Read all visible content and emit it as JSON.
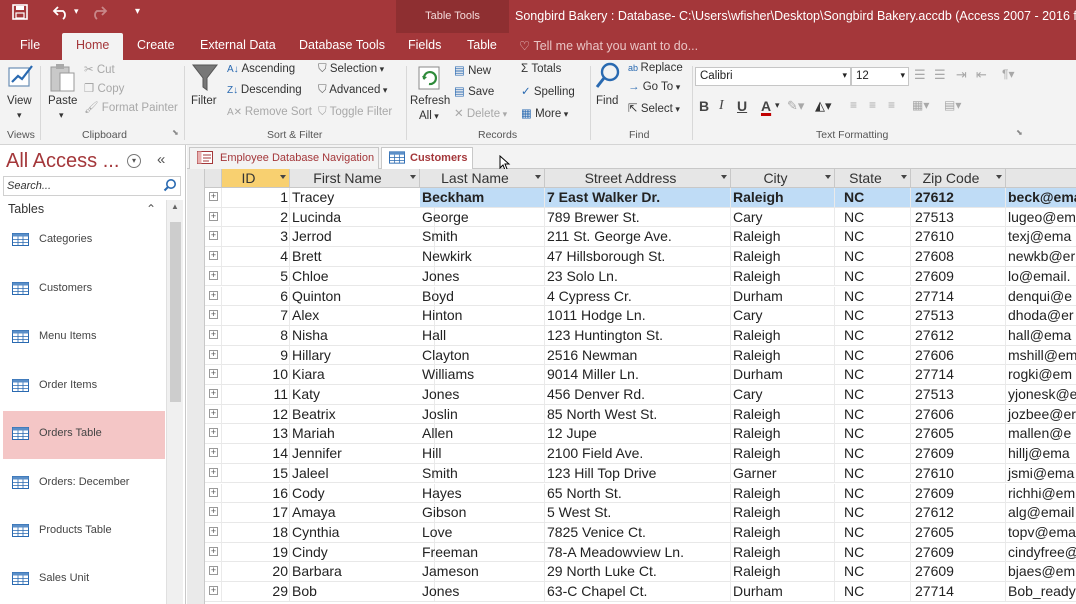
{
  "titlebar": {
    "context_label": "Table Tools",
    "window_title": "Songbird Bakery : Database- C:\\Users\\wfisher\\Desktop\\Songbird Bakery.accdb (Access 2007 - 2016 file fo"
  },
  "tabs": [
    "File",
    "Home",
    "Create",
    "External Data",
    "Database Tools",
    "Fields",
    "Table"
  ],
  "tell_me": "Tell me what you want to do...",
  "ribbon": {
    "views": {
      "view": "View",
      "group": "Views"
    },
    "clipboard": {
      "paste": "Paste",
      "cut": "Cut",
      "copy": "Copy",
      "format_painter": "Format Painter",
      "group": "Clipboard"
    },
    "sort_filter": {
      "filter": "Filter",
      "ascending": "Ascending",
      "descending": "Descending",
      "remove_sort": "Remove Sort",
      "selection": "Selection",
      "advanced": "Advanced",
      "toggle_filter": "Toggle Filter",
      "group": "Sort & Filter"
    },
    "records": {
      "refresh": "Refresh",
      "all": "All",
      "new": "New",
      "save": "Save",
      "delete": "Delete",
      "totals": "Totals",
      "spelling": "Spelling",
      "more": "More",
      "group": "Records"
    },
    "find": {
      "find": "Find",
      "replace": "Replace",
      "goto": "Go To",
      "select": "Select",
      "group": "Find"
    },
    "text_formatting": {
      "font": "Calibri",
      "size": "12",
      "bold": "B",
      "italic": "I",
      "underline": "U",
      "font_color": "A",
      "group": "Text Formatting"
    }
  },
  "nav": {
    "title": "All Access ...",
    "search_placeholder": "Search...",
    "section": "Tables",
    "items": [
      {
        "label": "Categories"
      },
      {
        "label": "Customers"
      },
      {
        "label": "Menu Items"
      },
      {
        "label": "Order Items"
      },
      {
        "label": "Orders Table"
      },
      {
        "label": "Orders: December"
      },
      {
        "label": "Products Table"
      },
      {
        "label": "Sales Unit"
      }
    ]
  },
  "doc_tabs": [
    {
      "label": "Employee Database Navigation"
    },
    {
      "label": "Customers"
    }
  ],
  "columns": [
    "ID",
    "First Name",
    "Last Name",
    "Street Address",
    "City",
    "State",
    "Zip Code"
  ],
  "rows": [
    {
      "id": "1",
      "first": "Tracey",
      "last": "Beckham",
      "street": "7 East Walker Dr.",
      "city": "Raleigh",
      "state": "NC",
      "zip": "27612",
      "email": "beck@ema"
    },
    {
      "id": "2",
      "first": "Lucinda",
      "last": "George",
      "street": "789 Brewer St.",
      "city": "Cary",
      "state": "NC",
      "zip": "27513",
      "email": "lugeo@em"
    },
    {
      "id": "3",
      "first": "Jerrod",
      "last": "Smith",
      "street": "211 St. George Ave.",
      "city": "Raleigh",
      "state": "NC",
      "zip": "27610",
      "email": "texj@ema"
    },
    {
      "id": "4",
      "first": "Brett",
      "last": "Newkirk",
      "street": "47 Hillsborough St.",
      "city": "Raleigh",
      "state": "NC",
      "zip": "27608",
      "email": "newkb@er"
    },
    {
      "id": "5",
      "first": "Chloe",
      "last": "Jones",
      "street": "23 Solo Ln.",
      "city": "Raleigh",
      "state": "NC",
      "zip": "27609",
      "email": "lo@email."
    },
    {
      "id": "6",
      "first": "Quinton",
      "last": "Boyd",
      "street": "4 Cypress Cr.",
      "city": "Durham",
      "state": "NC",
      "zip": "27714",
      "email": "denqui@e"
    },
    {
      "id": "7",
      "first": "Alex",
      "last": "Hinton",
      "street": "1011 Hodge Ln.",
      "city": "Cary",
      "state": "NC",
      "zip": "27513",
      "email": "dhoda@er"
    },
    {
      "id": "8",
      "first": "Nisha",
      "last": "Hall",
      "street": "123 Huntington St.",
      "city": "Raleigh",
      "state": "NC",
      "zip": "27612",
      "email": "hall@ema"
    },
    {
      "id": "9",
      "first": "Hillary",
      "last": "Clayton",
      "street": "2516 Newman",
      "city": "Raleigh",
      "state": "NC",
      "zip": "27606",
      "email": "mshill@em"
    },
    {
      "id": "10",
      "first": "Kiara",
      "last": "Williams",
      "street": "9014 Miller Ln.",
      "city": "Durham",
      "state": "NC",
      "zip": "27714",
      "email": "rogki@em"
    },
    {
      "id": "11",
      "first": "Katy",
      "last": "Jones",
      "street": "456 Denver Rd.",
      "city": "Cary",
      "state": "NC",
      "zip": "27513",
      "email": "yjonesk@e"
    },
    {
      "id": "12",
      "first": "Beatrix",
      "last": "Joslin",
      "street": "85 North West St.",
      "city": "Raleigh",
      "state": "NC",
      "zip": "27606",
      "email": "jozbee@er"
    },
    {
      "id": "13",
      "first": "Mariah",
      "last": "Allen",
      "street": "12 Jupe",
      "city": "Raleigh",
      "state": "NC",
      "zip": "27605",
      "email": "mallen@e"
    },
    {
      "id": "14",
      "first": "Jennifer",
      "last": "Hill",
      "street": "2100 Field Ave.",
      "city": "Raleigh",
      "state": "NC",
      "zip": "27609",
      "email": "hillj@ema"
    },
    {
      "id": "15",
      "first": "Jaleel",
      "last": "Smith",
      "street": "123 Hill Top Drive",
      "city": "Garner",
      "state": "NC",
      "zip": "27610",
      "email": "jsmi@ema"
    },
    {
      "id": "16",
      "first": "Cody",
      "last": "Hayes",
      "street": "65 North St.",
      "city": "Raleigh",
      "state": "NC",
      "zip": "27609",
      "email": "richhi@em"
    },
    {
      "id": "17",
      "first": "Amaya",
      "last": "Gibson",
      "street": "5 West St.",
      "city": "Raleigh",
      "state": "NC",
      "zip": "27612",
      "email": "alg@email"
    },
    {
      "id": "18",
      "first": "Cynthia",
      "last": "Love",
      "street": "7825 Venice Ct.",
      "city": "Raleigh",
      "state": "NC",
      "zip": "27605",
      "email": "topv@ema"
    },
    {
      "id": "19",
      "first": "Cindy",
      "last": "Freeman",
      "street": "78-A Meadowview Ln.",
      "city": "Raleigh",
      "state": "NC",
      "zip": "27609",
      "email": "cindyfree@"
    },
    {
      "id": "20",
      "first": "Barbara",
      "last": "Jameson",
      "street": "29 North Luke Ct.",
      "city": "Raleigh",
      "state": "NC",
      "zip": "27609",
      "email": "bjaes@em"
    },
    {
      "id": "29",
      "first": "Bob",
      "last": "Jones",
      "street": "63-C Chapel Ct.",
      "city": "Durham",
      "state": "NC",
      "zip": "27714",
      "email": "Bob_ready"
    }
  ],
  "colors": {
    "brand": "#a4373a",
    "selected_row": "#bfdcf6",
    "selected_header": "#f8d070",
    "nav_selected": "#f4c6c6"
  }
}
